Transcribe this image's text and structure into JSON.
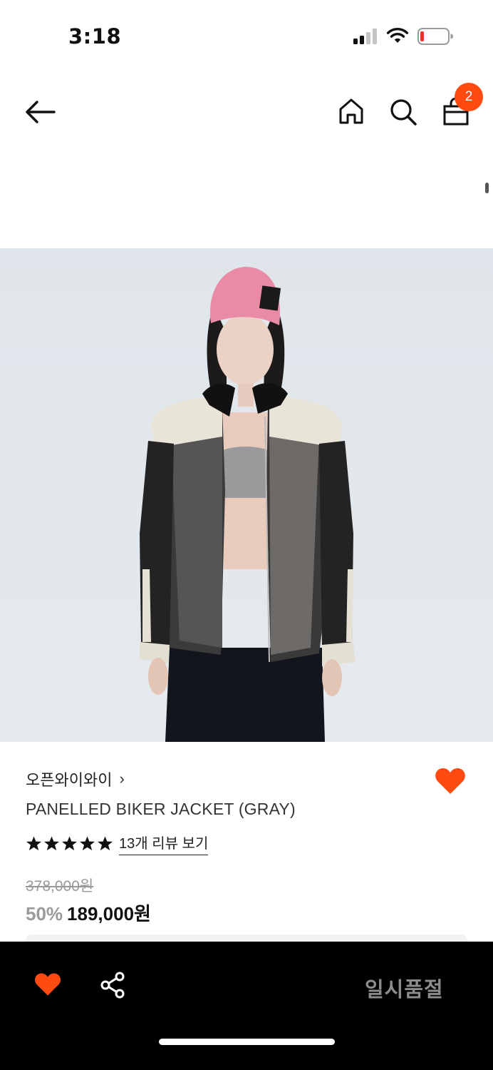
{
  "status_bar": {
    "time": "3:18",
    "battery_color": "#e5332a"
  },
  "nav": {
    "back_icon": "arrow-left-icon",
    "home_icon": "home-icon",
    "search_icon": "search-icon",
    "bag_icon": "shopping-bag-icon",
    "bag_badge_count": "2",
    "badge_color": "#ff4b12"
  },
  "product": {
    "image_alt": "model wearing panelled biker jacket",
    "brand": "오픈와이와이",
    "brand_chevron": "›",
    "name": "PANELLED BIKER JACKET (GRAY)",
    "rating_stars": 5,
    "review_link": "13개 리뷰 보기",
    "original_price": "378,000원",
    "discount": "50%",
    "sale_price": "189,000원",
    "wish_color": "#ff4b12"
  },
  "bottom_bar": {
    "wish_icon": "heart-icon",
    "share_icon": "share-icon",
    "cta_label": "일시품절"
  }
}
